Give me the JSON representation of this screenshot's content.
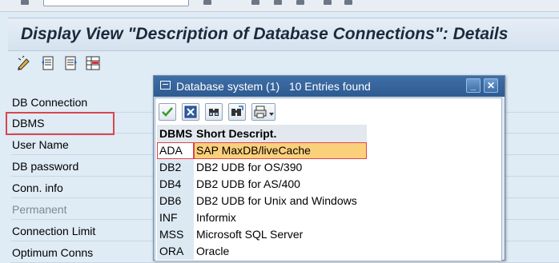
{
  "window": {
    "title": "Display View \"Description of Database Connections\": Details"
  },
  "app_toolbar": {
    "icons": [
      "edit-pencil-icon",
      "previous-entry-icon",
      "next-entry-icon",
      "select-block-icon"
    ]
  },
  "form": {
    "fields": [
      {
        "label": "DB Connection",
        "disabled": false
      },
      {
        "label": "DBMS",
        "disabled": false
      },
      {
        "label": "User Name",
        "disabled": false
      },
      {
        "label": "DB password",
        "disabled": false
      },
      {
        "label": "Conn. info",
        "disabled": false
      },
      {
        "label": "Permanent",
        "disabled": true
      },
      {
        "label": "Connection Limit",
        "disabled": false
      },
      {
        "label": "Optimum Conns",
        "disabled": false
      }
    ]
  },
  "popup": {
    "title": "Database system (1)",
    "count_text": "10 Entries found",
    "minimize_symbol": "_",
    "close_symbol": "✕",
    "toolbar_icons": [
      "continue-check-icon",
      "cancel-x-icon",
      "find-binoculars-icon",
      "find-next-icon",
      "print-icon"
    ],
    "table": {
      "headers": [
        "DBMS",
        "Short Descript."
      ],
      "rows": [
        {
          "code": "ADA",
          "desc": "SAP MaxDB/liveCache",
          "selected": true
        },
        {
          "code": "DB2",
          "desc": "DB2 UDB for OS/390",
          "selected": false
        },
        {
          "code": "DB4",
          "desc": "DB2 UDB for AS/400",
          "selected": false
        },
        {
          "code": "DB6",
          "desc": "DB2 UDB for Unix and Windows",
          "selected": false
        },
        {
          "code": "INF",
          "desc": "Informix",
          "selected": false
        },
        {
          "code": "MSS",
          "desc": "Microsoft SQL Server",
          "selected": false
        },
        {
          "code": "ORA",
          "desc": "Oracle",
          "selected": false
        }
      ]
    }
  },
  "colors": {
    "background": "#dfebf5",
    "popup_title_bar": "#2d5a91",
    "selection": "#fbd07b",
    "highlight_box": "#d8474d"
  }
}
